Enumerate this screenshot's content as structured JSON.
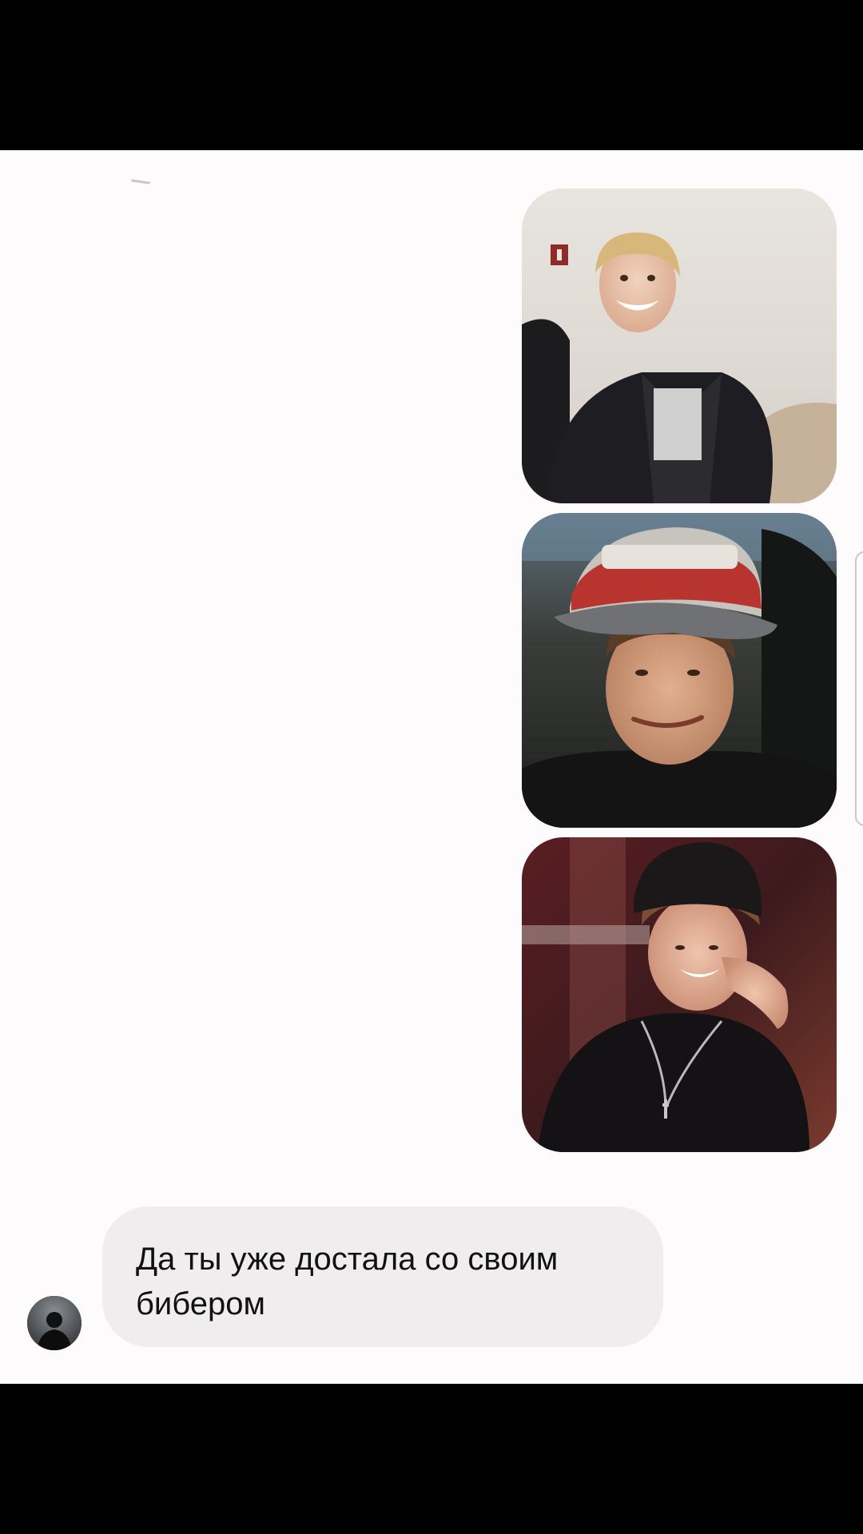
{
  "conversation": {
    "sent_photos": [
      {
        "icon": "photo-young-man-leather-jacket-smiling"
      },
      {
        "icon": "photo-young-man-red-cap-grimace"
      },
      {
        "icon": "photo-young-man-black-cap-laughing"
      }
    ],
    "received_message": {
      "avatar_icon": "user-avatar-dark",
      "text": "Да ты уже достала со своим\nбибером"
    }
  },
  "colors": {
    "chat_background": "#fdfbfb",
    "bubble_background": "#efeded",
    "letterbox": "#000000"
  }
}
